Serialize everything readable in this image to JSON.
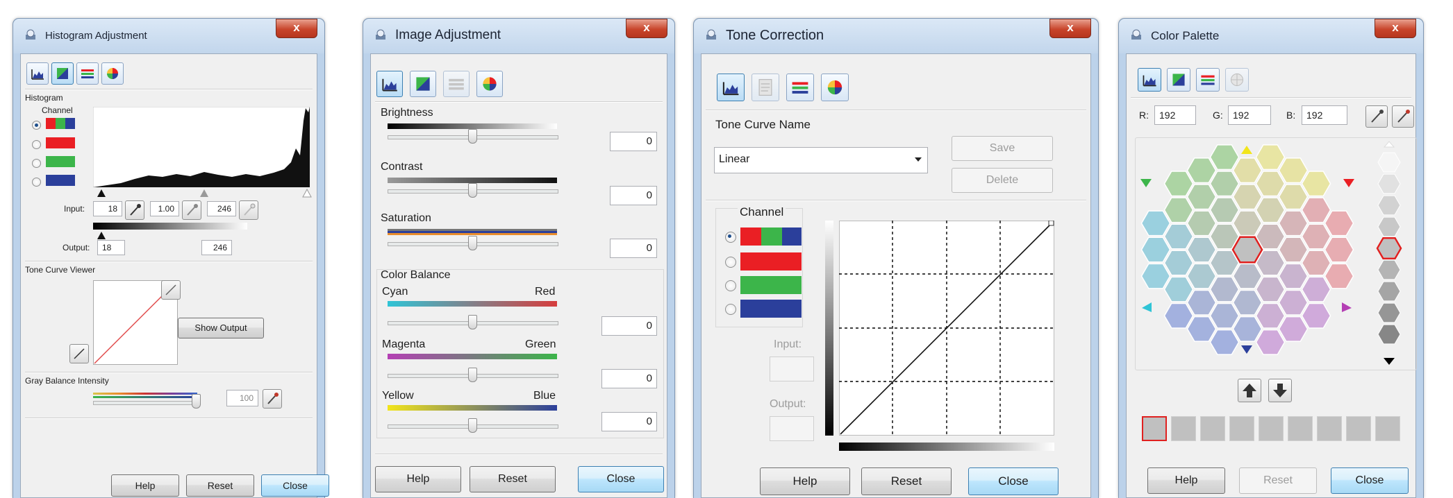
{
  "colors": {
    "red": "#ea1f24",
    "green": "#3cb54a",
    "blue": "#2b3f9b",
    "accent": "#3c7fb1"
  },
  "histogram_window": {
    "title": "Histogram Adjustment",
    "close_glyph": "x",
    "section_histogram": "Histogram",
    "channel_label": "Channel",
    "input_label": "Input:",
    "input_low": "18",
    "input_gamma": "1.00",
    "input_high": "246",
    "output_label": "Output:",
    "output_low": "18",
    "output_high": "246",
    "section_tone_curve": "Tone Curve Viewer",
    "show_output_label": "Show Output",
    "section_gray": "Gray Balance Intensity",
    "gray_value": "100",
    "help_label": "Help",
    "reset_label": "Reset",
    "close_label": "Close"
  },
  "image_window": {
    "title": "Image Adjustment",
    "close_glyph": "x",
    "brightness_label": "Brightness",
    "brightness_value": "0",
    "contrast_label": "Contrast",
    "contrast_value": "0",
    "saturation_label": "Saturation",
    "saturation_value": "0",
    "color_balance_label": "Color Balance",
    "cyan_label": "Cyan",
    "red_label": "Red",
    "cyan_red_value": "0",
    "magenta_label": "Magenta",
    "green_label": "Green",
    "magenta_green_value": "0",
    "yellow_label": "Yellow",
    "blue_label": "Blue",
    "yellow_blue_value": "0",
    "help_label": "Help",
    "reset_label": "Reset",
    "close_label": "Close"
  },
  "tone_window": {
    "title": "Tone Correction",
    "close_glyph": "x",
    "tone_curve_name_label": "Tone Curve Name",
    "tone_curve_value": "Linear",
    "save_label": "Save",
    "delete_label": "Delete",
    "channel_label": "Channel",
    "input_label": "Input:",
    "output_label": "Output:",
    "help_label": "Help",
    "reset_label": "Reset",
    "close_label": "Close"
  },
  "palette_window": {
    "title": "Color Palette",
    "close_glyph": "x",
    "r_label": "R:",
    "r_value": "192",
    "g_label": "G:",
    "g_value": "192",
    "b_label": "B:",
    "b_value": "192",
    "help_label": "Help",
    "reset_label": "Reset",
    "close_label": "Close"
  }
}
